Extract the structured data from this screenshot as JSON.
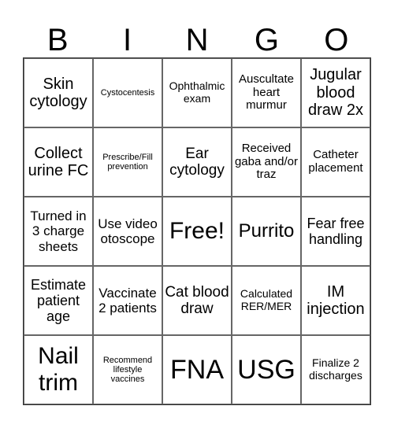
{
  "header": {
    "letters": [
      "B",
      "I",
      "N",
      "G",
      "O"
    ]
  },
  "cells": [
    [
      "Skin cytology",
      "Cystocentesis",
      "Ophthalmic exam",
      "Auscultate heart murmur",
      "Jugular blood draw 2x"
    ],
    [
      "Collect urine FC",
      "Prescribe/Fill prevention",
      "Ear cytology",
      "Received gaba and/or traz",
      "Catheter placement"
    ],
    [
      "Turned in 3 charge sheets",
      "Use video otoscope",
      "Free!",
      "Purrito",
      "Fear free handling"
    ],
    [
      "Estimate patient age",
      "Vaccinate 2 patients",
      "Cat blood draw",
      "Calculated RER/MER",
      "IM injection"
    ],
    [
      "Nail trim",
      "Recommend lifestyle vaccines",
      "FNA",
      "USG",
      "Finalize 2 discharges"
    ]
  ]
}
